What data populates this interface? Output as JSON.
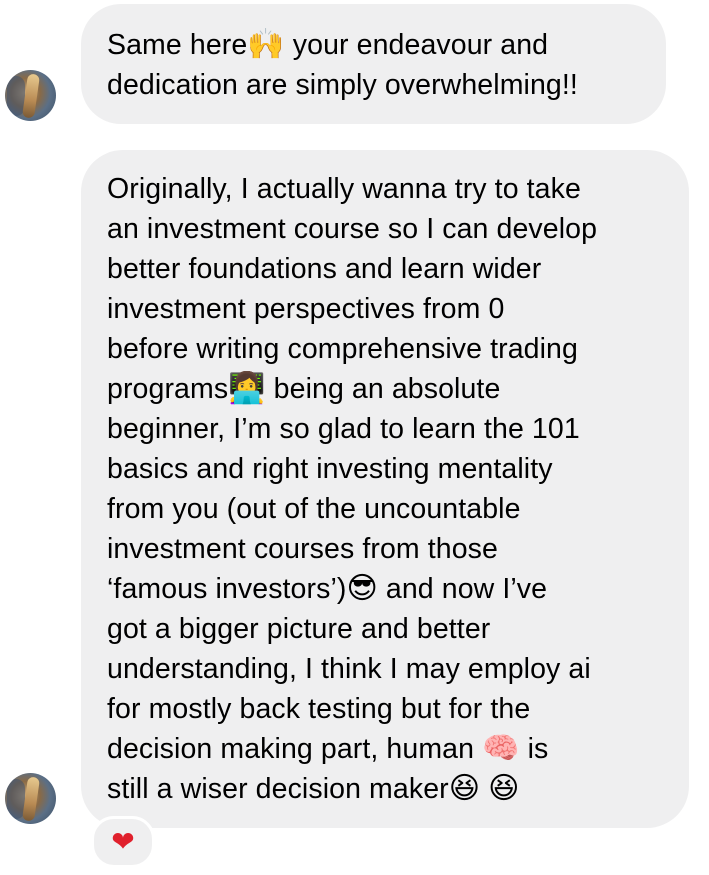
{
  "messages": [
    {
      "id": "msg1",
      "lines": [
        [
          "Same here",
          "🙌",
          " your endeavour and"
        ],
        [
          "dedication are simply overwhelming!!"
        ]
      ]
    },
    {
      "id": "msg2",
      "lines": [
        [
          "Originally, I actually wanna try to take"
        ],
        [
          "an investment course so I can develop"
        ],
        [
          "better foundations and learn wider"
        ],
        [
          "investment perspectives from 0"
        ],
        [
          "before writing comprehensive trading"
        ],
        [
          "programs",
          "👩‍💻",
          " being an absolute"
        ],
        [
          "beginner, I’m so glad to learn the 101"
        ],
        [
          "basics and right investing mentality"
        ],
        [
          "from you (out of the uncountable"
        ],
        [
          "investment courses from those"
        ],
        [
          "‘famous investors’)",
          "😎",
          " and now I’ve"
        ],
        [
          "got a bigger picture and better"
        ],
        [
          "understanding, I think I may employ ai"
        ],
        [
          "for mostly back testing but for the"
        ],
        [
          "decision making part, human ",
          "🧠",
          " is"
        ],
        [
          "still a wiser decision maker",
          "😆",
          " ",
          "😆"
        ]
      ],
      "reaction": {
        "icon": "heart-icon",
        "glyph": "❤",
        "color": "#e0202c"
      }
    }
  ],
  "colors": {
    "bubble_background": "#efeff0",
    "text": "#000000",
    "reaction_heart": "#e0202c"
  },
  "icons": [
    "avatar-photo",
    "raising-hands-emoji",
    "woman-technologist-emoji",
    "smiling-face-with-sunglasses-emoji",
    "brain-emoji",
    "grinning-squinting-face-emoji",
    "heart-icon"
  ]
}
